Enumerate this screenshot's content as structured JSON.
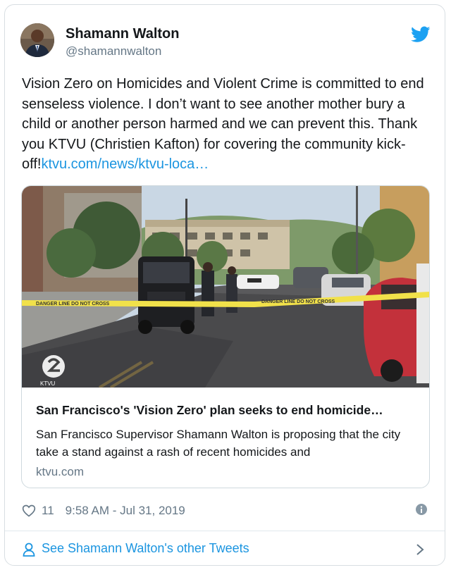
{
  "tweet": {
    "author_name": "Shamann Walton",
    "author_handle": "@shamannwalton",
    "text": "Vision Zero on Homicides and Violent Crime is committed to end senseless violence. I don’t want to see another mother bury a child or another person harmed and we can prevent this. Thank you KTVU (Christien Kafton) for covering the community kick-off!",
    "link_text": "ktvu.com/news/ktvu-loca…",
    "likes": "11",
    "timestamp": "9:58 AM - Jul 31, 2019"
  },
  "link_card": {
    "title": "San Francisco's 'Vision Zero' plan seeks to end homicide…",
    "description": "San Francisco Supervisor Shamann Walton is proposing that the city take a stand against a rash of recent homicides and",
    "domain": "ktvu.com",
    "image_overlay": "KTVU",
    "tape_text": "DANGER LINE DO NOT CROSS"
  },
  "footer": {
    "more_label": "See Shamann Walton's other Tweets"
  },
  "colors": {
    "link_blue": "#1b95e0",
    "text": "#14171a",
    "muted": "#657786",
    "twitter_blue": "#1da1f2"
  },
  "icons": [
    "twitter-bird-icon",
    "heart-icon",
    "info-icon",
    "person-icon",
    "chevron-right-icon"
  ]
}
